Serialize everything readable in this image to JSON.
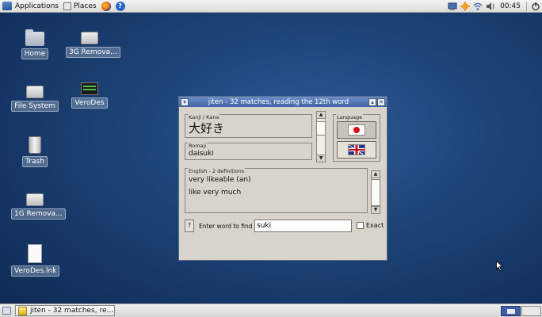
{
  "top_panel": {
    "applications": "Applications",
    "places": "Places",
    "clock": "00:45"
  },
  "desktop_icons": [
    {
      "label": "Home"
    },
    {
      "label": "3G Remova..."
    },
    {
      "label": "File System"
    },
    {
      "label": "VeroDes"
    },
    {
      "label": "Trash"
    },
    {
      "label": "1G Remova..."
    },
    {
      "label": "VeroDes.lnk"
    }
  ],
  "window": {
    "title": "jiten - 32 matches, reading the 12th word",
    "kanji_label": "Kanji / Kana",
    "kanji_value": "大好き",
    "romaji_label": "Romaji",
    "romaji_value": "daisuki",
    "language_label": "Language",
    "english_label": "English - 2 definitions",
    "definitions": [
      "very likeable (an)",
      "like very much"
    ],
    "help_label": "?",
    "find_label": "Enter word to find",
    "search_value": "suki",
    "exact_label": "Exact"
  },
  "taskbar": {
    "task_label": "jiten - 32 matches, re..."
  }
}
